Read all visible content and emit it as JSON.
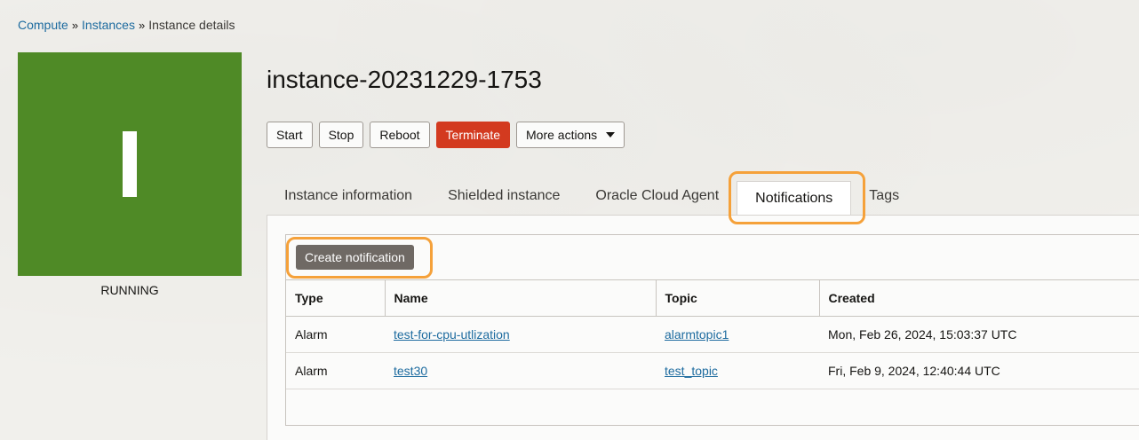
{
  "breadcrumb": {
    "items": [
      "Compute",
      "Instances"
    ],
    "separator": "»",
    "current": "Instance details"
  },
  "instance": {
    "avatar_letter": "I",
    "status": "RUNNING",
    "name": "instance-20231229-1753"
  },
  "actions": {
    "start": "Start",
    "stop": "Stop",
    "reboot": "Reboot",
    "terminate": "Terminate",
    "more": "More actions"
  },
  "tabs": [
    {
      "label": "Instance information"
    },
    {
      "label": "Shielded instance"
    },
    {
      "label": "Oracle Cloud Agent"
    },
    {
      "label": "Notifications",
      "active": true
    },
    {
      "label": "Tags"
    }
  ],
  "notifications": {
    "create_label": "Create notification",
    "columns": [
      "Type",
      "Name",
      "Topic",
      "Created"
    ],
    "rows": [
      {
        "type": "Alarm",
        "name": "test-for-cpu-utlization",
        "topic": "alarmtopic1",
        "created": "Mon, Feb 26, 2024, 15:03:37 UTC"
      },
      {
        "type": "Alarm",
        "name": "test30",
        "topic": "test_topic",
        "created": "Fri, Feb 9, 2024, 12:40:44 UTC"
      }
    ]
  },
  "colors": {
    "badge": "#4f8a26",
    "terminate": "#d33a1f",
    "link": "#1d6b9f",
    "highlight": "#f5a13a",
    "create_button": "#6f6964"
  }
}
